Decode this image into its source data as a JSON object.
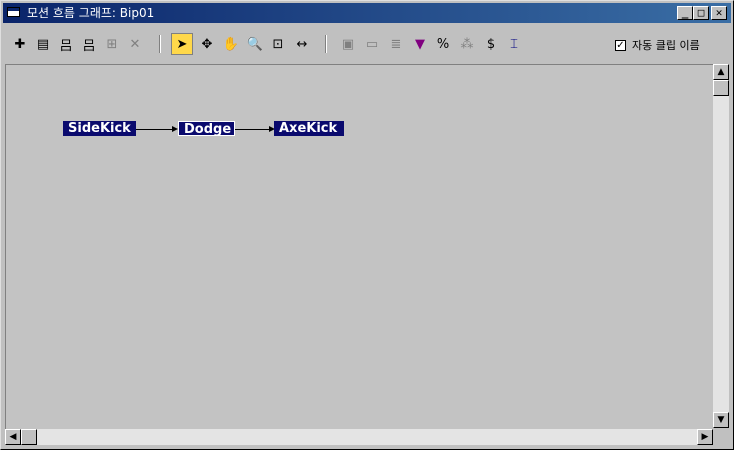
{
  "window": {
    "title": "모션 흐름 그래프: Bip01",
    "controls": {
      "minimize": "_",
      "maximize": "□",
      "close": "✕"
    }
  },
  "toolbar": {
    "tools": [
      {
        "name": "create-clip",
        "glyph": "✚"
      },
      {
        "name": "open-file",
        "glyph": "▤"
      },
      {
        "name": "save-file",
        "glyph": "吕"
      },
      {
        "name": "insert-clip",
        "glyph": "吕"
      },
      {
        "name": "delete-clip",
        "glyph": "⊞"
      },
      {
        "name": "delete",
        "glyph": "✕"
      },
      {
        "name": "select",
        "glyph": "➤"
      },
      {
        "name": "move",
        "glyph": "✥"
      },
      {
        "name": "pan",
        "glyph": "✋"
      },
      {
        "name": "zoom",
        "glyph": "🔍"
      },
      {
        "name": "zoom-region",
        "glyph": "⊡"
      },
      {
        "name": "fit",
        "glyph": "↔"
      },
      {
        "name": "tool-a",
        "glyph": "▣"
      },
      {
        "name": "tool-b",
        "glyph": "▭"
      },
      {
        "name": "tool-c",
        "glyph": "≣"
      },
      {
        "name": "tool-d",
        "glyph": "▼"
      },
      {
        "name": "percent",
        "glyph": "%"
      },
      {
        "name": "random",
        "glyph": "⁂"
      },
      {
        "name": "dollar",
        "glyph": "$"
      },
      {
        "name": "tool-e",
        "glyph": "⌶"
      }
    ],
    "auto_clip_label": "자동 클립 이름",
    "auto_clip_checked": true
  },
  "graph": {
    "nodes": [
      {
        "label": "SideKick"
      },
      {
        "label": "Dodge"
      },
      {
        "label": "AxeKick"
      }
    ]
  },
  "scroll": {
    "up": "▲",
    "down": "▼",
    "left": "◀",
    "right": "▶"
  }
}
